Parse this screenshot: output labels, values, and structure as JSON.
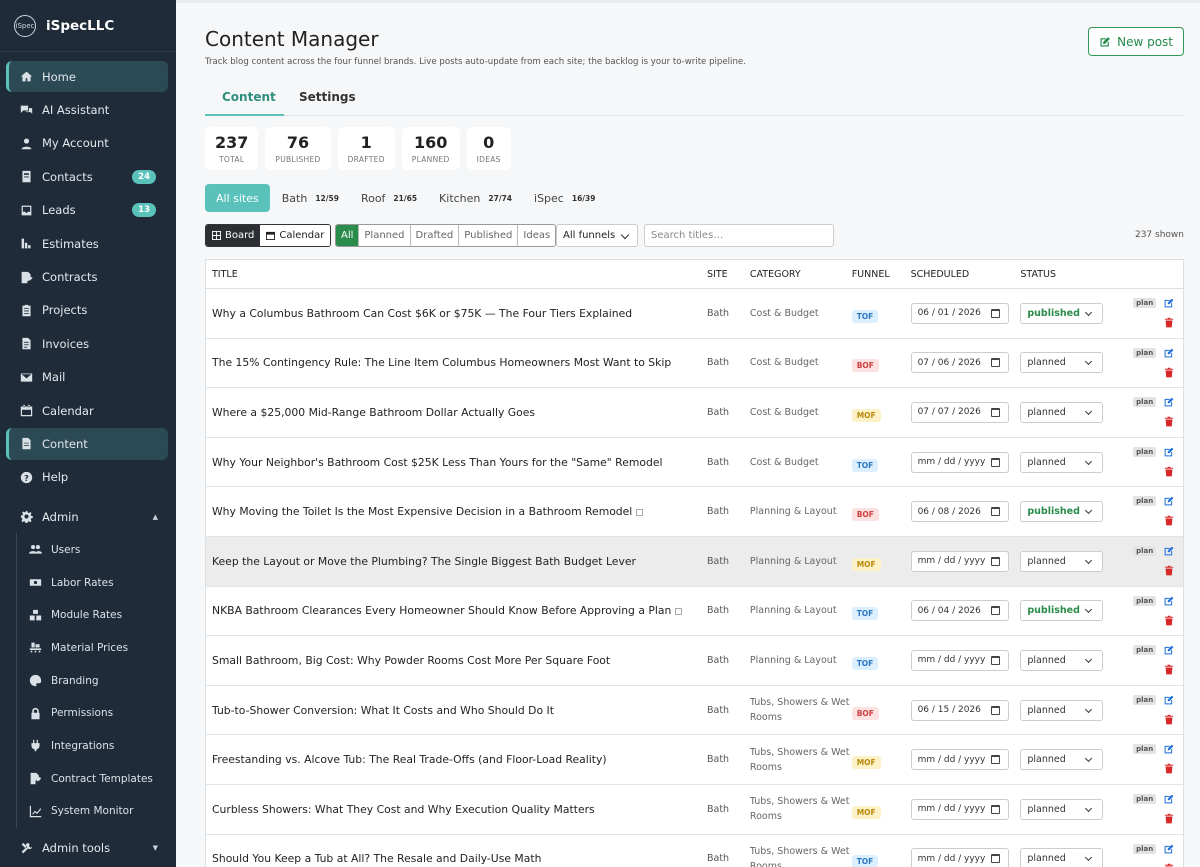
{
  "brand": {
    "logo_text": "iSpec",
    "name": "iSpecLLC"
  },
  "nav": [
    {
      "label": "Home",
      "icon": "home-icon",
      "active": true
    },
    {
      "label": "AI Assistant",
      "icon": "chat-icon"
    },
    {
      "label": "My Account",
      "icon": "user-icon"
    },
    {
      "label": "Contacts",
      "icon": "contacts-icon",
      "badge": "24"
    },
    {
      "label": "Leads",
      "icon": "inbox-icon",
      "badge": "13"
    },
    {
      "label": "Estimates",
      "icon": "estimate-icon"
    },
    {
      "label": "Contracts",
      "icon": "contract-icon"
    },
    {
      "label": "Projects",
      "icon": "clipboard-icon"
    },
    {
      "label": "Invoices",
      "icon": "invoice-icon"
    },
    {
      "label": "Mail",
      "icon": "mail-icon"
    },
    {
      "label": "Calendar",
      "icon": "calendar-icon"
    },
    {
      "label": "Content",
      "icon": "file-icon",
      "active": true
    },
    {
      "label": "Help",
      "icon": "help-icon"
    },
    {
      "label": "Admin",
      "icon": "gear-icon",
      "caret": "▲"
    }
  ],
  "admin_sub": [
    {
      "label": "Users",
      "icon": "users-icon"
    },
    {
      "label": "Labor Rates",
      "icon": "money-icon"
    },
    {
      "label": "Module Rates",
      "icon": "cubes-icon"
    },
    {
      "label": "Material Prices",
      "icon": "pallet-icon"
    },
    {
      "label": "Branding",
      "icon": "palette-icon"
    },
    {
      "label": "Permissions",
      "icon": "lock-icon"
    },
    {
      "label": "Integrations",
      "icon": "plug-icon"
    },
    {
      "label": "Contract Templates",
      "icon": "template-icon"
    },
    {
      "label": "System Monitor",
      "icon": "chart-line-icon"
    }
  ],
  "admin_tools": {
    "label": "Admin tools",
    "caret": "▼"
  },
  "header": {
    "title": "Content Manager",
    "subtitle": "Track blog content across the four funnel brands. Live posts auto-update from each site; the backlog is your to-write pipeline.",
    "new_post": "New post"
  },
  "tabs": [
    {
      "label": "Content",
      "active": true
    },
    {
      "label": "Settings"
    }
  ],
  "stats": [
    {
      "num": "237",
      "label": "TOTAL"
    },
    {
      "num": "76",
      "label": "PUBLISHED"
    },
    {
      "num": "1",
      "label": "DRAFTED"
    },
    {
      "num": "160",
      "label": "PLANNED"
    },
    {
      "num": "0",
      "label": "IDEAS"
    }
  ],
  "sites": [
    {
      "label": "All sites",
      "count": "",
      "active": true
    },
    {
      "label": "Bath",
      "count": "12/59"
    },
    {
      "label": "Roof",
      "count": "21/65"
    },
    {
      "label": "Kitchen",
      "count": "27/74"
    },
    {
      "label": "iSpec",
      "count": "16/39"
    }
  ],
  "toolbar": {
    "board": "Board",
    "calendar": "Calendar",
    "filters": [
      "All",
      "Planned",
      "Drafted",
      "Published",
      "Ideas"
    ],
    "funnel_select": "All funnels",
    "search_placeholder": "Search titles…",
    "shown": "237 shown"
  },
  "columns": {
    "title": "TITLE",
    "site": "SITE",
    "category": "CATEGORY",
    "funnel": "FUNNEL",
    "scheduled": "SCHEDULED",
    "status": "STATUS"
  },
  "rows": [
    {
      "title": "Why a Columbus Bathroom Can Cost $6K or $75K — The Four Tiers Explained",
      "site": "Bath",
      "category": "Cost & Budget",
      "funnel": "TOF",
      "scheduled": "06 / 01 / 2026",
      "status": "published",
      "tag": "plan"
    },
    {
      "title": "The 15% Contingency Rule: The Line Item Columbus Homeowners Most Want to Skip",
      "site": "Bath",
      "category": "Cost & Budget",
      "funnel": "BOF",
      "scheduled": "07 / 06 / 2026",
      "status": "planned",
      "tag": "plan"
    },
    {
      "title": "Where a $25,000 Mid-Range Bathroom Dollar Actually Goes",
      "site": "Bath",
      "category": "Cost & Budget",
      "funnel": "MOF",
      "scheduled": "07 / 07 / 2026",
      "status": "planned",
      "tag": "plan"
    },
    {
      "title": "Why Your Neighbor's Bathroom Cost $25K Less Than Yours for the \"Same\" Remodel",
      "site": "Bath",
      "category": "Cost & Budget",
      "funnel": "TOF",
      "scheduled": "mm / dd / yyyy",
      "status": "planned",
      "tag": "plan"
    },
    {
      "title": "Why Moving the Toilet Is the Most Expensive Decision in a Bathroom Remodel",
      "site": "Bath",
      "category": "Planning & Layout",
      "funnel": "BOF",
      "scheduled": "06 / 08 / 2026",
      "status": "published",
      "tag": "plan",
      "external": true
    },
    {
      "title": "Keep the Layout or Move the Plumbing? The Single Biggest Bath Budget Lever",
      "site": "Bath",
      "category": "Planning & Layout",
      "funnel": "MOF",
      "scheduled": "mm / dd / yyyy",
      "status": "planned",
      "tag": "plan",
      "highlight": true
    },
    {
      "title": "NKBA Bathroom Clearances Every Homeowner Should Know Before Approving a Plan",
      "site": "Bath",
      "category": "Planning & Layout",
      "funnel": "TOF",
      "scheduled": "06 / 04 / 2026",
      "status": "published",
      "tag": "plan",
      "external": true
    },
    {
      "title": "Small Bathroom, Big Cost: Why Powder Rooms Cost More Per Square Foot",
      "site": "Bath",
      "category": "Planning & Layout",
      "funnel": "TOF",
      "scheduled": "mm / dd / yyyy",
      "status": "planned",
      "tag": "plan"
    },
    {
      "title": "Tub-to-Shower Conversion: What It Costs and Who Should Do It",
      "site": "Bath",
      "category": "Tubs, Showers & Wet Rooms",
      "funnel": "BOF",
      "scheduled": "06 / 15 / 2026",
      "status": "planned",
      "tag": "plan"
    },
    {
      "title": "Freestanding vs. Alcove Tub: The Real Trade-Offs (and Floor-Load Reality)",
      "site": "Bath",
      "category": "Tubs, Showers & Wet Rooms",
      "funnel": "MOF",
      "scheduled": "mm / dd / yyyy",
      "status": "planned",
      "tag": "plan"
    },
    {
      "title": "Curbless Showers: What They Cost and Why Execution Quality Matters",
      "site": "Bath",
      "category": "Tubs, Showers & Wet Rooms",
      "funnel": "MOF",
      "scheduled": "mm / dd / yyyy",
      "status": "planned",
      "tag": "plan"
    },
    {
      "title": "Should You Keep a Tub at All? The Resale and Daily-Use Math",
      "site": "Bath",
      "category": "Tubs, Showers & Wet Rooms",
      "funnel": "TOF",
      "scheduled": "mm / dd / yyyy",
      "status": "planned",
      "tag": "plan"
    }
  ]
}
